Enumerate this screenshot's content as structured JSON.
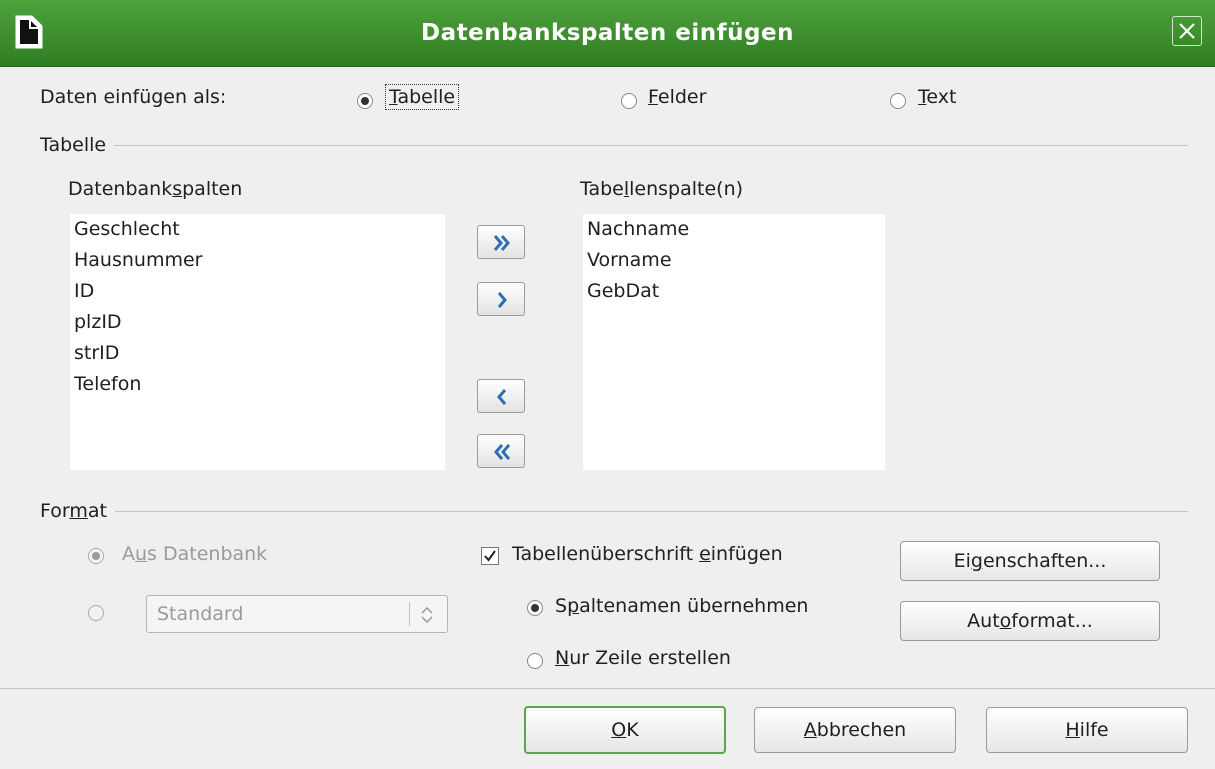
{
  "window": {
    "title": "Datenbankspalten einfügen"
  },
  "insert_as": {
    "label": "Daten einfügen als:",
    "options": [
      {
        "mn_before": "",
        "mn": "T",
        "mn_after": "abelle",
        "selected": true
      },
      {
        "mn_before": "",
        "mn": "F",
        "mn_after": "elder",
        "selected": false
      },
      {
        "mn_before": "",
        "mn": "T",
        "mn_after": "ext",
        "selected": false
      }
    ]
  },
  "table_group": {
    "label": "Tabelle"
  },
  "db_columns": {
    "header_before": "Datenbank",
    "header_mn": "s",
    "header_after": "palten",
    "items": [
      "Geschlecht",
      "Hausnummer",
      "ID",
      "plzID",
      "strID",
      "Telefon"
    ]
  },
  "table_columns": {
    "header_before": "Tabe",
    "header_mn": "l",
    "header_after": "lenspalte(n)",
    "items": [
      "Nachname",
      "Vorname",
      "GebDat"
    ]
  },
  "format_group": {
    "label_before": "For",
    "label_mn": "m",
    "label_after": "at"
  },
  "format": {
    "from_db_before": "A",
    "from_db_mn": "u",
    "from_db_after": "s Datenbank",
    "from_db_selected": true,
    "standard_value": "Standard",
    "insert_heading_before": "Tabellenüberschrift ",
    "insert_heading_mn": "e",
    "insert_heading_after": "infügen",
    "insert_heading_checked": true,
    "apply_names_before": "S",
    "apply_names_mn": "p",
    "apply_names_after": "altenamen übernehmen",
    "apply_names_selected": true,
    "create_row_before": "",
    "create_row_mn": "N",
    "create_row_after": "ur Zeile erstellen",
    "properties_before": "Ei",
    "properties_mn": "g",
    "properties_after": "enschaften...",
    "autoformat_before": "Aut",
    "autoformat_mn": "o",
    "autoformat_after": "format..."
  },
  "buttons": {
    "ok_before": "",
    "ok_mn": "O",
    "ok_after": "K",
    "cancel_before": "",
    "cancel_mn": "A",
    "cancel_after": "bbrechen",
    "help_before": "",
    "help_mn": "H",
    "help_after": "ilfe"
  },
  "colors": {
    "titlebar": "#3a8f2c",
    "arrow": "#2c6fb3"
  }
}
